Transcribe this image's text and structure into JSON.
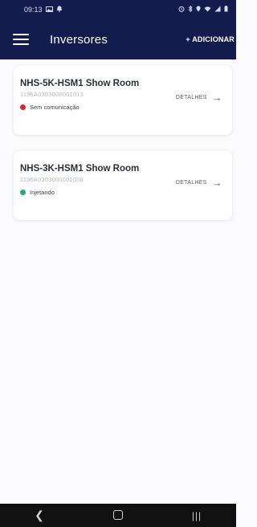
{
  "status_bar": {
    "time": "09:13",
    "left_icons": [
      "image-icon",
      "notification-icon"
    ],
    "right_icons": [
      "alarm-icon",
      "bluetooth-icon",
      "location-icon",
      "wifi-icon",
      "signal-icon",
      "battery-icon"
    ]
  },
  "app_bar": {
    "title": "Inversores",
    "add_label": "+ ADICIONAR",
    "menu_icon": "menu-icon"
  },
  "inverters": [
    {
      "name": "NHS-5K-HSM1 Show Room",
      "serial": "1196A0303000001013",
      "status": "Sem comunicação",
      "status_color": "#e0242b",
      "details_label": "DETALHES"
    },
    {
      "name": "NHS-3K-HSM1 Show Room",
      "serial": "1196A0303000001008",
      "status": "Injetando",
      "status_color": "#1fae7c",
      "details_label": "DETALHES"
    }
  ],
  "nav_bar": {
    "back_icon": "back-icon",
    "home_icon": "home-icon",
    "recents_icon": "recents-icon"
  },
  "colors": {
    "header_bg": "#141c4e",
    "page_bg": "#fbfbfd",
    "card_bg": "#ffffff"
  }
}
